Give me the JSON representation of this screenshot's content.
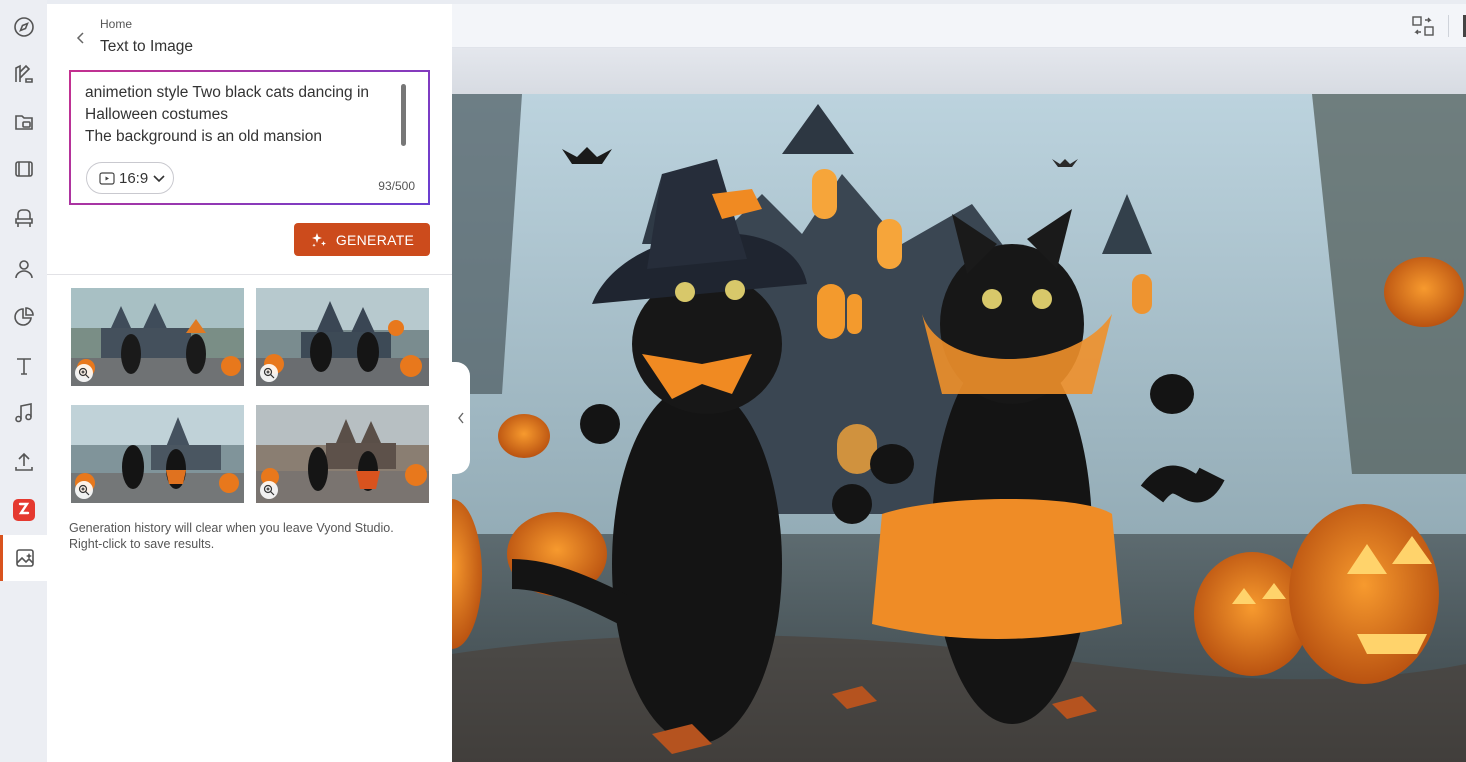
{
  "breadcrumb": "Home",
  "page_title": "Text to Image",
  "prompt": {
    "text": "animetion style Two black cats dancing in Halloween costumes\nThe background is an old mansion",
    "char_count": "93/500",
    "aspect_ratio": "16:9"
  },
  "generate_label": "GENERATE",
  "history_note": "Generation history will clear when you leave Vyond Studio. Right-click to save results.",
  "sidebar_icons": [
    "compass-icon",
    "paint-brush-icon",
    "media-library-icon",
    "film-icon",
    "chair-prop-icon",
    "character-icon",
    "chart-pie-icon",
    "text-icon",
    "music-note-icon",
    "upload-icon",
    "brand-app-icon",
    "ai-image-icon"
  ],
  "colors": {
    "accent": "#cc4b1c",
    "prompt_border": "#a52bb4",
    "active_marker": "#d9531e"
  },
  "results_count": 4
}
